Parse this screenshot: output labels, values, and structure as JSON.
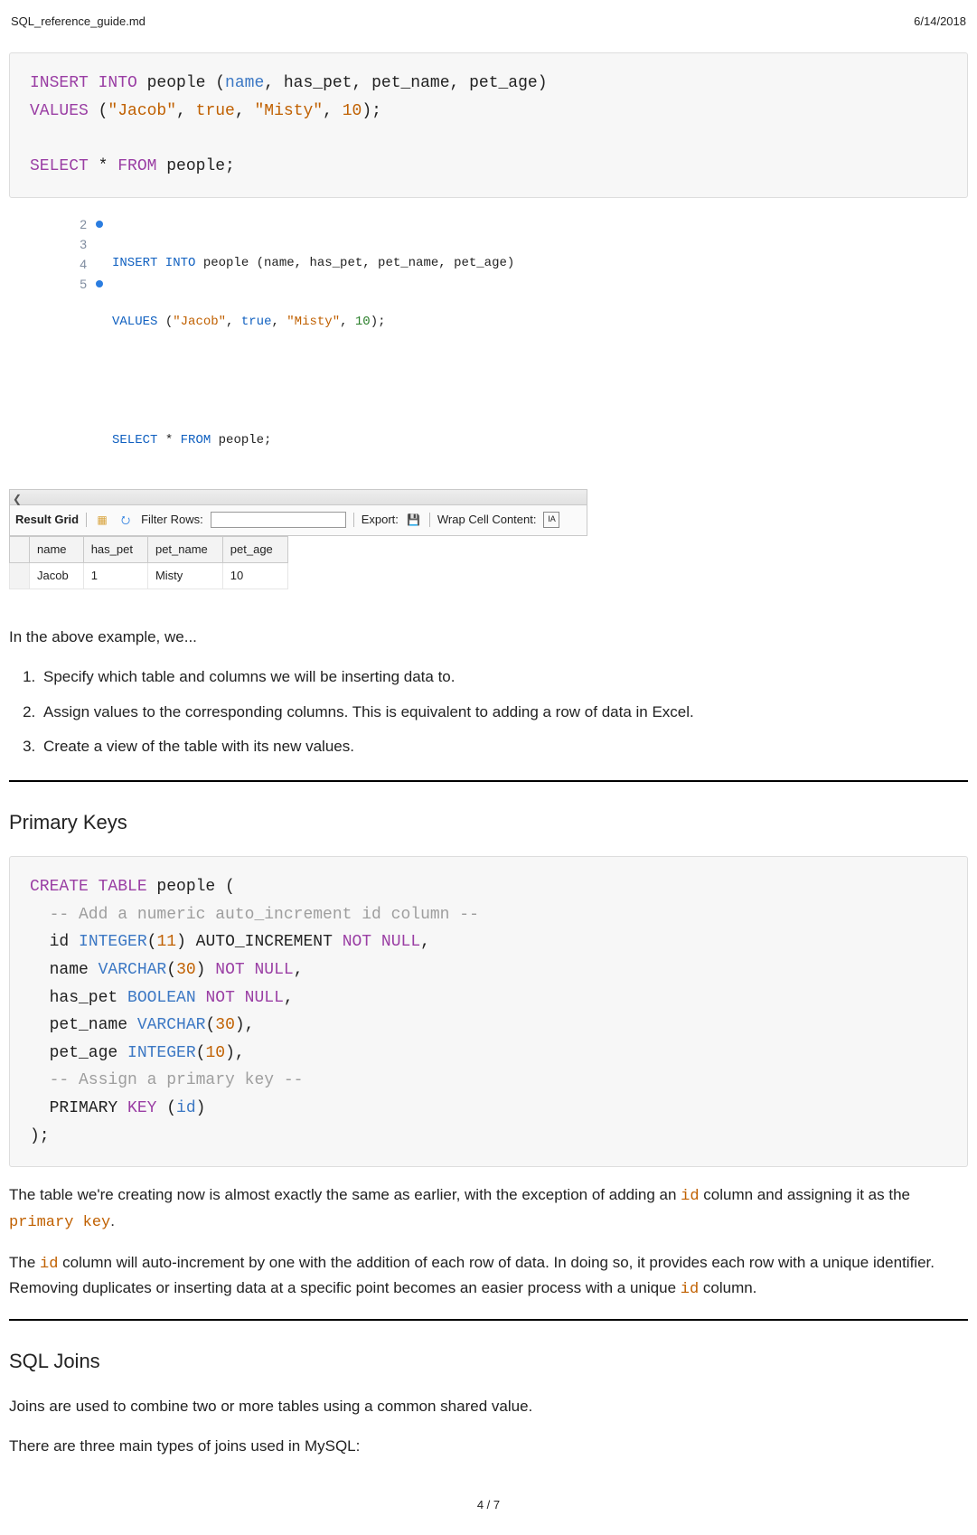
{
  "header": {
    "filename": "SQL_reference_guide.md",
    "date": "6/14/2018"
  },
  "code1": {
    "l1": {
      "a": "INSERT INTO",
      "b": " people (",
      "c": "name",
      "d": ", has_pet, pet_name, pet_age)"
    },
    "l2": {
      "a": "VALUES",
      "b": " (",
      "s1": "\"Jacob\"",
      "c": ", ",
      "bool": "true",
      "d": ", ",
      "s2": "\"Misty\"",
      "e": ", ",
      "num": "10",
      "f": ");"
    },
    "l4": {
      "a": "SELECT",
      "b": " * ",
      "c": "FROM",
      "d": " people;"
    }
  },
  "editor": {
    "lines": [
      "2",
      "3",
      "4",
      "5"
    ],
    "ln2a": "INSERT INTO",
    "ln2b": " people (name, has_pet, pet_name, pet_age)",
    "ln3a": "VALUES",
    "ln3b": " (",
    "ln3s1": "\"Jacob\"",
    "ln3c": ", ",
    "ln3bool": "true",
    "ln3d": ", ",
    "ln3s2": "\"Misty\"",
    "ln3e": ", ",
    "ln3num": "10",
    "ln3f": ");",
    "ln5a": "SELECT",
    "ln5b": " * ",
    "ln5c": "FROM",
    "ln5d": " people;",
    "toolbar": {
      "result_grid": "Result Grid",
      "filter_label": "Filter Rows:",
      "filter_value": "",
      "export": "Export:",
      "wrap": "Wrap Cell Content:"
    },
    "table": {
      "headers": [
        "name",
        "has_pet",
        "pet_name",
        "pet_age"
      ],
      "row": [
        "Jacob",
        "1",
        "Misty",
        "10"
      ]
    }
  },
  "para_intro": "In the above example, we...",
  "steps": [
    "Specify which table and columns we will be inserting data to.",
    "Assign values to the corresponding columns. This is equivalent to adding a row of data in Excel.",
    "Create a view of the table with its new values."
  ],
  "sect_pk": "Primary Keys",
  "code2": {
    "l1a": "CREATE TABLE",
    "l1b": " people (",
    "l2": "  -- Add a numeric auto_increment id column --",
    "l3a": "  id ",
    "l3b": "INTEGER",
    "l3c": "(",
    "l3d": "11",
    "l3e": ") AUTO_INCREMENT ",
    "l3f": "NOT NULL",
    "l3g": ",",
    "l4a": "  name ",
    "l4b": "VARCHAR",
    "l4c": "(",
    "l4d": "30",
    "l4e": ") ",
    "l4f": "NOT NULL",
    "l4g": ",",
    "l5a": "  has_pet ",
    "l5b": "BOOLEAN",
    "l5c": " ",
    "l5d": "NOT NULL",
    "l5e": ",",
    "l6a": "  pet_name ",
    "l6b": "VARCHAR",
    "l6c": "(",
    "l6d": "30",
    "l6e": "),",
    "l7a": "  pet_age ",
    "l7b": "INTEGER",
    "l7c": "(",
    "l7d": "10",
    "l7e": "),",
    "l8": "  -- Assign a primary key --",
    "l9a": "  PRIMARY ",
    "l9b": "KEY",
    "l9c": " (",
    "l9d": "id",
    "l9e": ")",
    "l10": ");"
  },
  "para_pk1_a": "The table we're creating now is almost exactly the same as earlier, with the exception of adding an ",
  "para_pk1_b": " column and assigning it as the ",
  "para_pk1_c": ".",
  "code_id": "id",
  "code_pk": "primary key",
  "para_pk2_a": "The ",
  "para_pk2_b": " column will auto-increment by one with the addition of each row of data. In doing so, it provides each row with a unique identifier. Removing duplicates or inserting data at a specific point becomes an easier process with a unique ",
  "para_pk2_c": " column.",
  "sect_joins": "SQL Joins",
  "para_joins1": "Joins are used to combine two or more tables using a common shared value.",
  "para_joins2": "There are three main types of joins used in MySQL:",
  "pager": "4 / 7"
}
